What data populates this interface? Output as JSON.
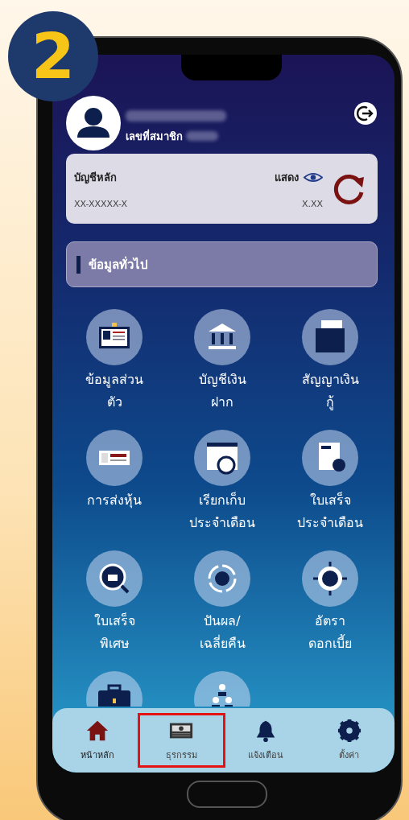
{
  "step_badge": "2",
  "header": {
    "member_label": "เลขที่สมาชิก"
  },
  "account": {
    "title": "บัญชีหลัก",
    "show_label": "แสดง",
    "number": "XX-XXXXX-X",
    "balance": "X.XX"
  },
  "section": {
    "title": "ข้อมูลทั่วไป"
  },
  "menu": [
    {
      "kind": "id-card",
      "lines": [
        "ข้อมูลส่วน",
        "ตัว"
      ]
    },
    {
      "kind": "bank",
      "lines": [
        "บัญชีเงิน",
        "ฝาก"
      ]
    },
    {
      "kind": "folder",
      "lines": [
        "สัญญาเงิน",
        "กู้"
      ]
    },
    {
      "kind": "cheque",
      "lines": [
        "การส่งหุ้น"
      ]
    },
    {
      "kind": "calendar",
      "lines": [
        "เรียกเก็บ",
        "ประจำเดือน"
      ]
    },
    {
      "kind": "receipt",
      "lines": [
        "ใบเสร็จ",
        "ประจำเดือน"
      ]
    },
    {
      "kind": "search-bank",
      "lines": [
        "ใบเสร็จ",
        "พิเศษ"
      ]
    },
    {
      "kind": "cycle",
      "lines": [
        "ปันผล/",
        "เฉลี่ยคืน"
      ]
    },
    {
      "kind": "target",
      "lines": [
        "อัตรา",
        "ดอกเบี้ย"
      ]
    },
    {
      "kind": "briefcase"
    },
    {
      "kind": "hierarchy"
    }
  ],
  "nav": [
    {
      "kind": "home",
      "label": "หน้าหลัก",
      "selected": true,
      "highlighted": false
    },
    {
      "kind": "money",
      "label": "ธุรกรรม",
      "selected": false,
      "highlighted": true
    },
    {
      "kind": "bell",
      "label": "แจ้งเตือน",
      "selected": false,
      "highlighted": false
    },
    {
      "kind": "gear",
      "label": "ตั้งค่า",
      "selected": false,
      "highlighted": false
    }
  ]
}
